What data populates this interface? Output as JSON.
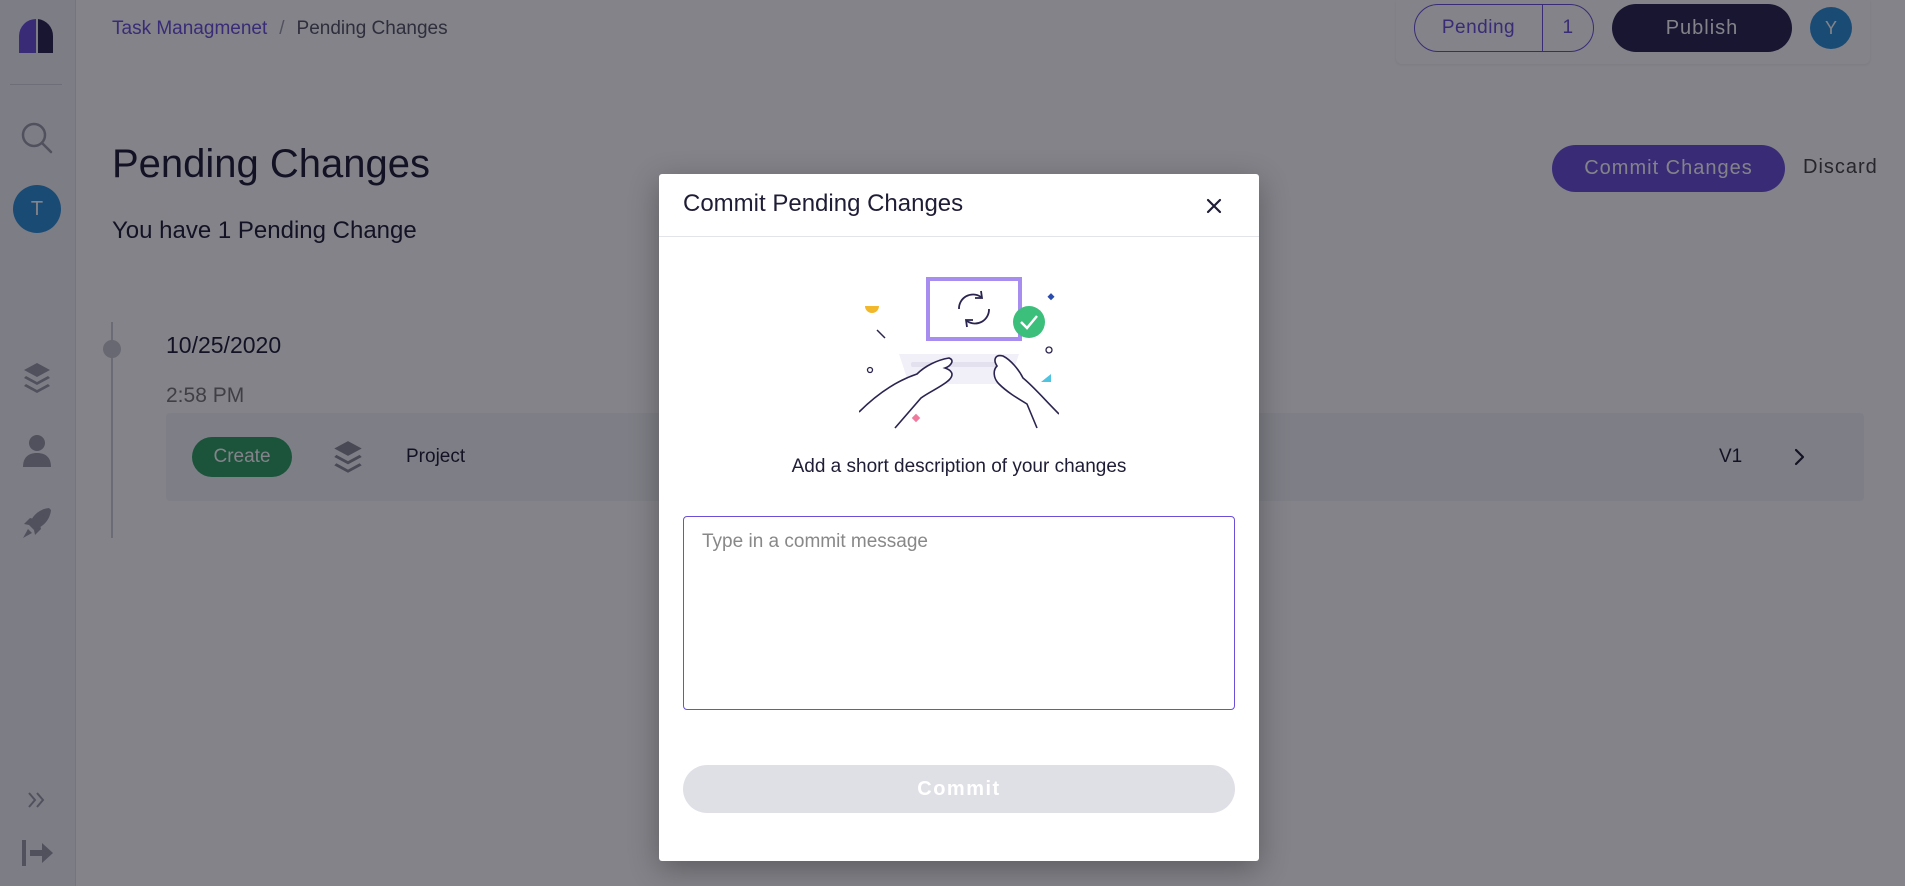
{
  "header": {
    "breadcrumb": [
      {
        "label": "Task Managmenet"
      },
      {
        "label": "Pending Changes"
      }
    ],
    "breadcrumb_separator": "/",
    "pending_label": "Pending",
    "pending_count": "1",
    "publish_label": "Publish",
    "user_initial": "Y"
  },
  "sidebar": {
    "workspace_initial": "T",
    "icons": [
      "logo-icon",
      "search-icon",
      "layers-icon",
      "user-icon",
      "rocket-icon",
      "expand-icon",
      "logout-icon"
    ]
  },
  "main": {
    "title": "Pending Changes",
    "subtitle": "You have 1 Pending Change",
    "commit_changes_label": "Commit Changes",
    "discard_label": "Discard",
    "timeline": {
      "date": "10/25/2020",
      "time": "2:58 PM",
      "changes": [
        {
          "action": "Create",
          "type_icon": "layers-icon",
          "name": "Project",
          "version": "V1"
        }
      ]
    }
  },
  "modal": {
    "title": "Commit Pending Changes",
    "prompt": "Add a short description of your changes",
    "textarea_placeholder": "Type in a commit message",
    "textarea_value": "",
    "commit_label": "Commit"
  },
  "colors": {
    "accent": "#6b4fd8",
    "dark": "#2a2450",
    "success": "#2e9e62",
    "avatar": "#2d8fd6",
    "disabled": "#dfdfe6"
  }
}
